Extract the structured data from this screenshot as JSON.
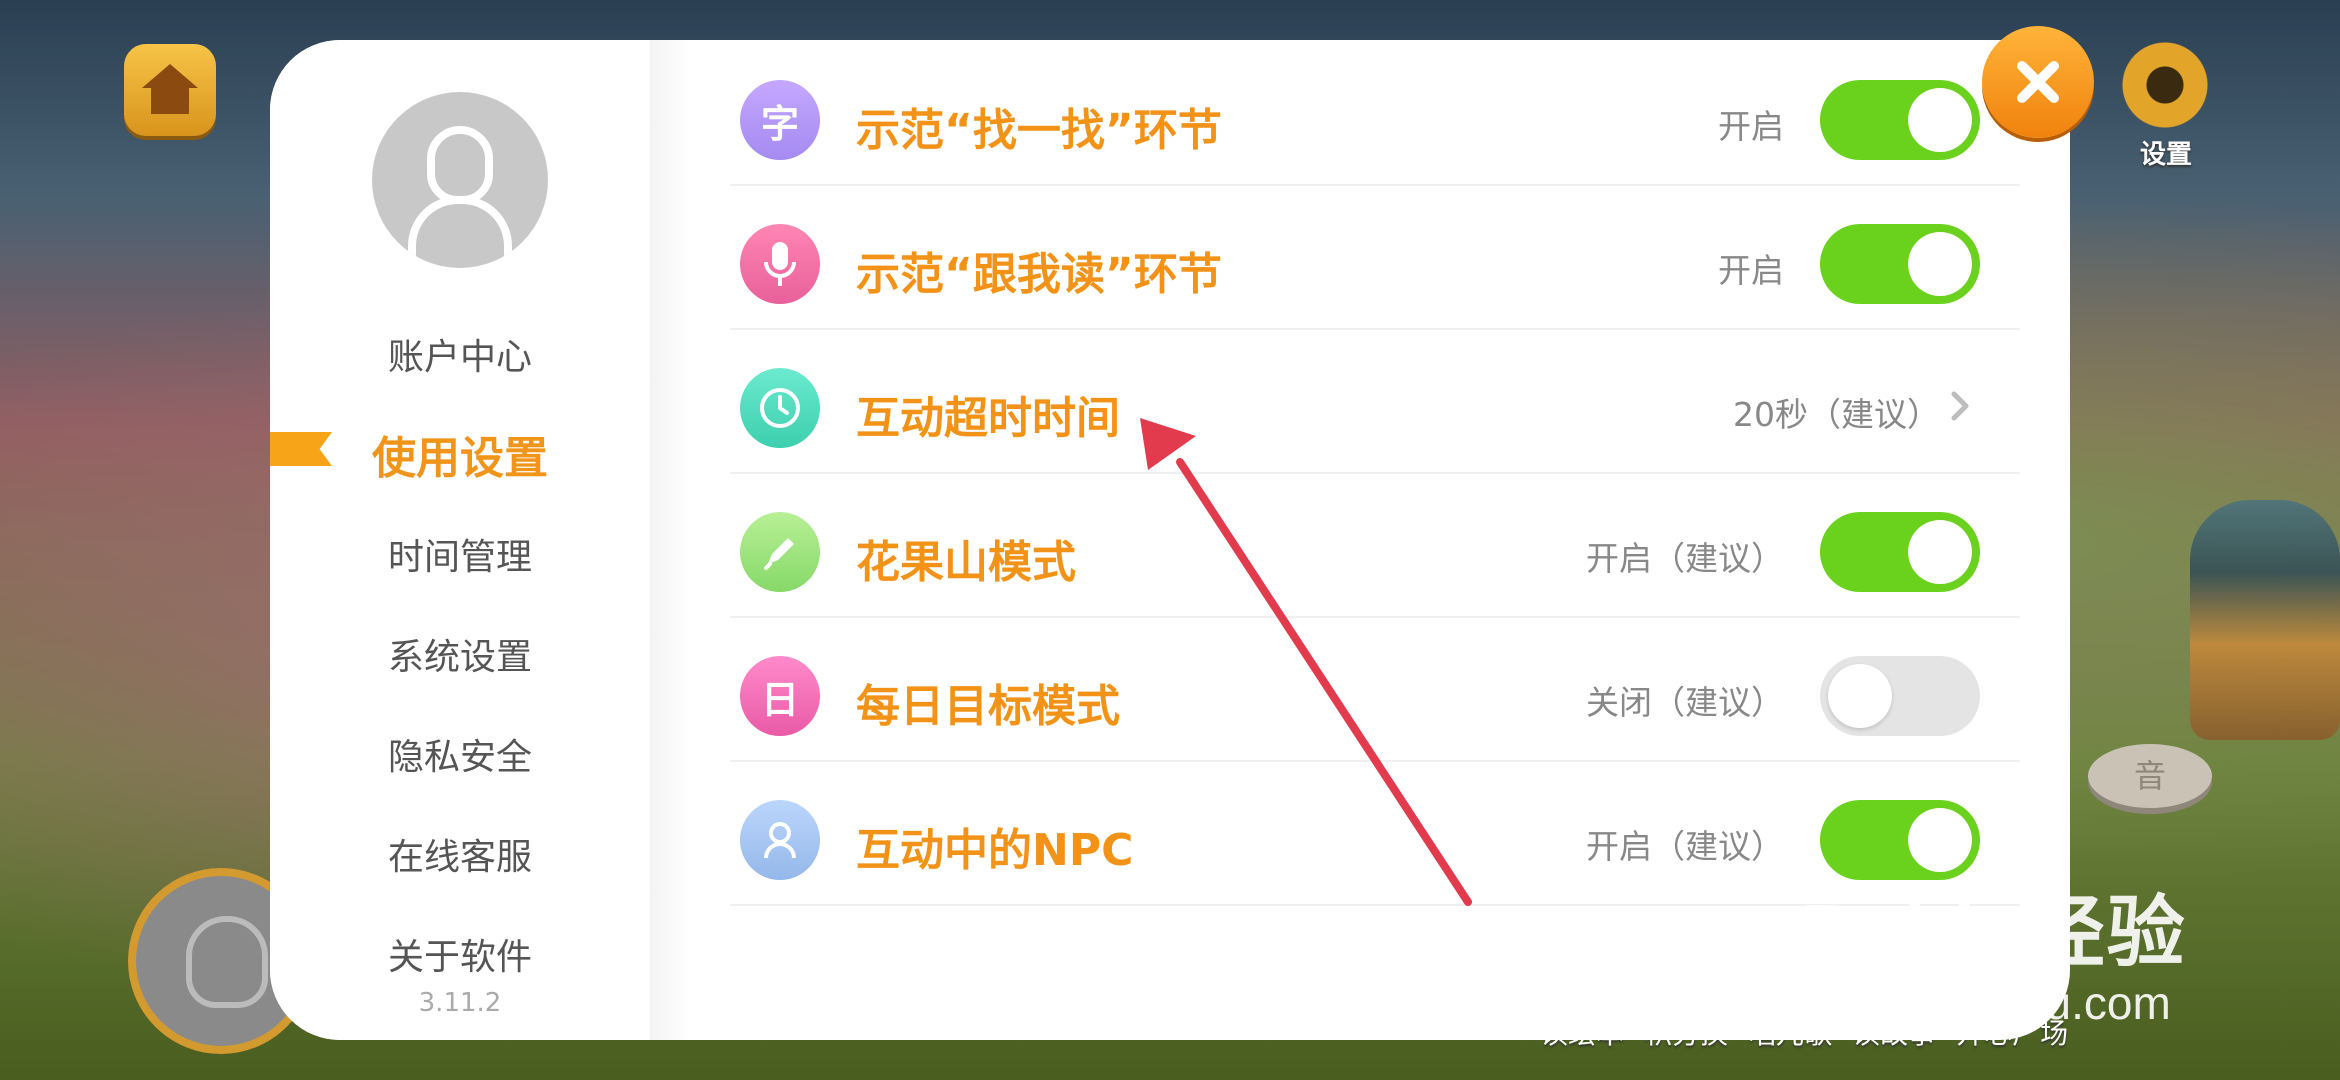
{
  "background": {
    "settings_label": "设置",
    "sound_label": "音",
    "bottom_nav": [
      "读绘本",
      "积分换",
      "唱儿歌",
      "读故事",
      "开心广场"
    ]
  },
  "sidebar": {
    "items": [
      "账户中心",
      "使用设置",
      "时间管理",
      "系统设置",
      "隐私安全",
      "在线客服",
      "关于软件"
    ],
    "active_index": 1,
    "version": "3.11.2"
  },
  "settings": [
    {
      "icon": "zi-character-icon",
      "icon_text": "字",
      "icon_color": "#b79af5",
      "label": "示范“找一找”环节",
      "status": "开启",
      "control": "toggle",
      "on": true
    },
    {
      "icon": "microphone-icon",
      "icon_text": "",
      "icon_color": "#f072a6",
      "label": "示范“跟我读”环节",
      "status": "开启",
      "control": "toggle",
      "on": true
    },
    {
      "icon": "clock-icon",
      "icon_text": "",
      "icon_color": "#55dcc0",
      "label": "互动超时时间",
      "status": "20秒（建议）",
      "control": "link",
      "on": null
    },
    {
      "icon": "pen-icon",
      "icon_text": "",
      "icon_color": "#9fe27e",
      "label": "花果山模式",
      "status": "开启（建议）",
      "control": "toggle",
      "on": true
    },
    {
      "icon": "calendar-ri-icon",
      "icon_text": "日",
      "icon_color": "#f46fb5",
      "label": "每日目标模式",
      "status": "关闭（建议）",
      "control": "toggle",
      "on": false
    },
    {
      "icon": "person-icon",
      "icon_text": "",
      "icon_color": "#a9c7f2",
      "label": "互动中的NPC",
      "status": "开启（建议）",
      "control": "toggle",
      "on": true
    }
  ],
  "colors": {
    "accent": "#f29318",
    "toggle_on": "#6ad11c",
    "toggle_off": "#e4e4e4",
    "annotation_arrow": "#e23b4e"
  },
  "watermark": {
    "brand": "Baidu经验",
    "url": "jingyan.baidu.com"
  }
}
